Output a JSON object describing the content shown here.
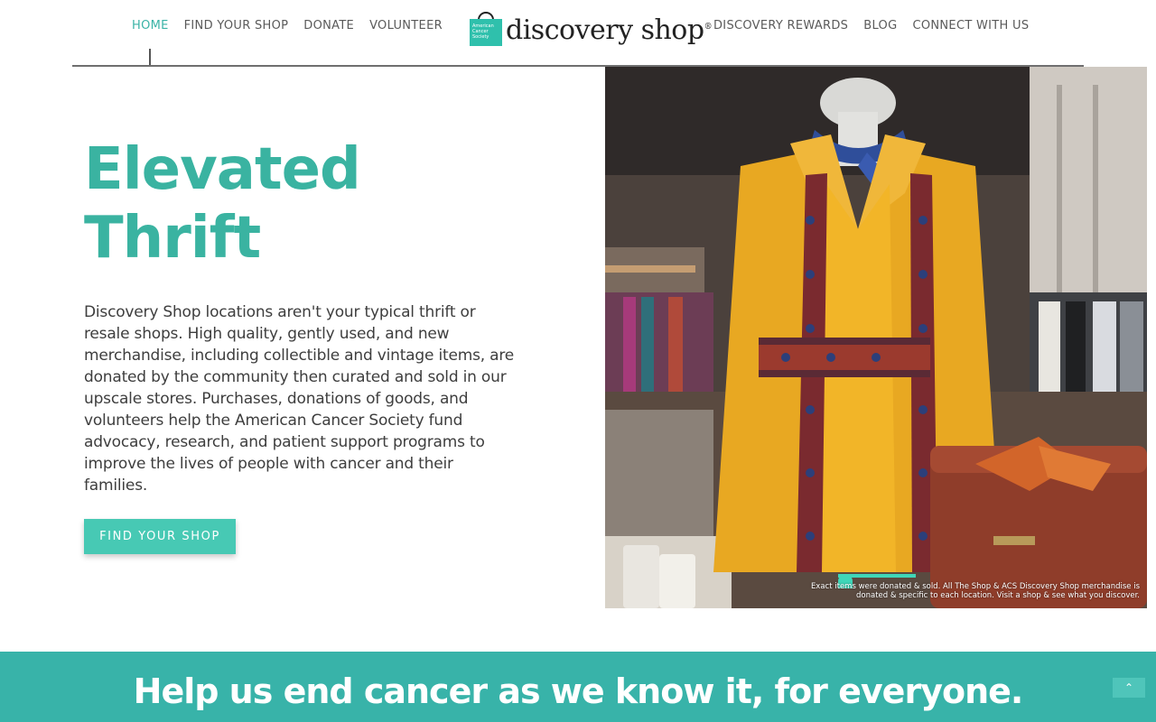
{
  "nav": {
    "left_items": [
      {
        "label": "HOME",
        "active": true
      },
      {
        "label": "FIND YOUR SHOP",
        "active": false
      },
      {
        "label": "DONATE",
        "active": false
      },
      {
        "label": "VOLUNTEER",
        "active": false
      }
    ],
    "right_items": [
      {
        "label": "DISCOVERY REWARDS",
        "active": false
      },
      {
        "label": "BLOG",
        "active": false
      },
      {
        "label": "CONNECT WITH US",
        "active": false
      }
    ]
  },
  "logo": {
    "badge_text": "American Cancer Society",
    "wordmark": "discovery shop",
    "trademark": "®"
  },
  "hero": {
    "title_line1": "Elevated",
    "title_line2": "Thrift",
    "body": "Discovery Shop locations aren't your typical thrift or resale shops. High quality, gently used, and new merchandise, including collectible and vintage items, are donated by the community then curated and sold in our upscale stores. Purchases, donations of goods, and volunteers help the American Cancer Society fund advocacy, research, and patient support programs to improve the lives of people with cancer and their families.",
    "cta_label": "FIND YOUR SHOP"
  },
  "photo": {
    "caption": "Exact items were donated & sold. All The Shop & ACS Discovery Shop merchandise is donated & specific to each location. Visit a shop & see what you discover."
  },
  "banner": {
    "title": "Help us end cancer as we know it, for everyone."
  },
  "colors": {
    "accent": "#3ab3a1",
    "button": "#47c9b4",
    "banner": "#38b3a9"
  },
  "icons": {
    "back_to_top": "chevron-up-icon"
  }
}
